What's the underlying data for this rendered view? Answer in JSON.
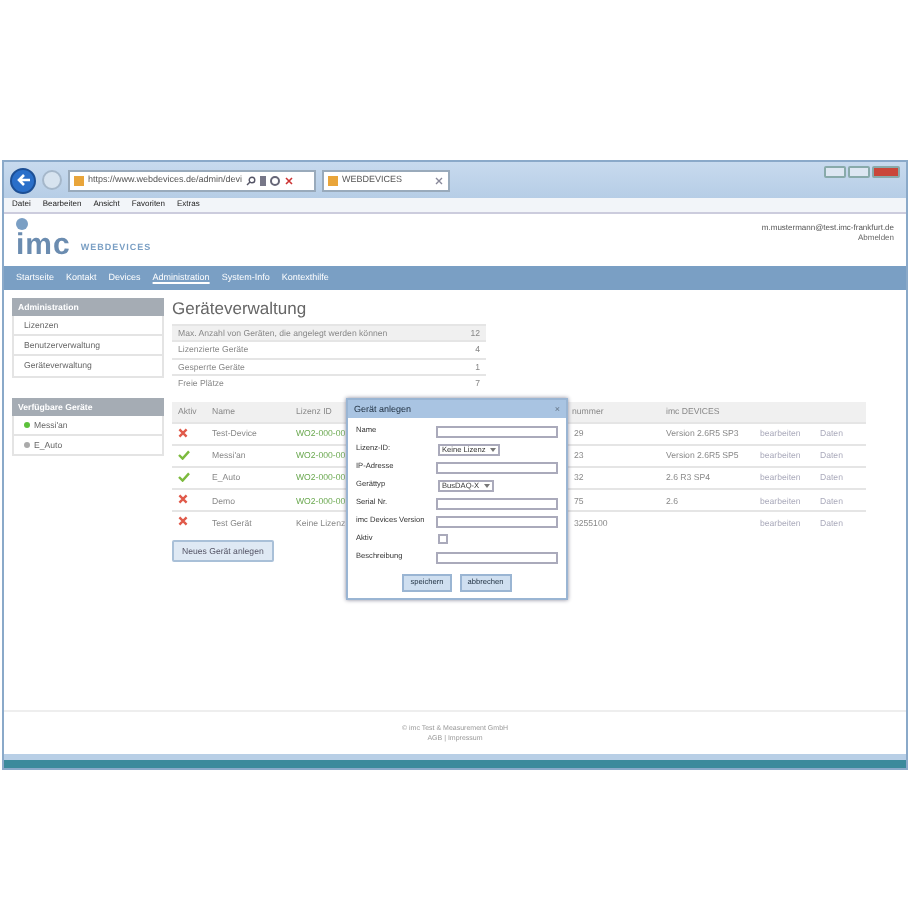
{
  "browser": {
    "address": "https://www.webdevices.de/admin/devi",
    "tab_title": "WEBDEVICES"
  },
  "menu": [
    "Datei",
    "Bearbeiten",
    "Ansicht",
    "Favoriten",
    "Extras"
  ],
  "header": {
    "logo": "imc",
    "brand": "WEBDEVICES",
    "user": "m.mustermann@test.imc-frankfurt.de",
    "logout": "Abmelden"
  },
  "nav": [
    {
      "label": "Startseite",
      "selected": false
    },
    {
      "label": "Kontakt",
      "selected": false
    },
    {
      "label": "Devices",
      "selected": false
    },
    {
      "label": "Administration",
      "selected": true
    },
    {
      "label": "System-Info",
      "selected": false
    },
    {
      "label": "Kontexthilfe",
      "selected": false
    }
  ],
  "sidebar": [
    {
      "title": "Administration",
      "items": [
        {
          "label": "Lizenzen"
        },
        {
          "label": "Benutzerverwaltung"
        },
        {
          "label": "Geräteverwaltung"
        }
      ]
    },
    {
      "title": "Verfügbare Geräte",
      "items": [
        {
          "label": "Messi'an",
          "online": true
        },
        {
          "label": "E_Auto",
          "online": false
        }
      ]
    }
  ],
  "page_title": "Geräteverwaltung",
  "stats": [
    {
      "label": "Max. Anzahl von Geräten, die angelegt werden können",
      "value": "12"
    },
    {
      "label": "Lizenzierte Geräte",
      "value": "4"
    },
    {
      "label": "Gesperrte Geräte",
      "value": "1"
    },
    {
      "label": "Freie Plätze",
      "value": "7"
    }
  ],
  "devices": {
    "columns": [
      "Aktiv",
      "Name",
      "Lizenz ID",
      "nummer",
      "imc DEVICES"
    ],
    "rows": [
      {
        "active": false,
        "name": "Test-Device",
        "license": "WO2-000-00",
        "licensed": true,
        "serial": "29",
        "version": "Version 2.6R5 SP3",
        "edit": "bearbeiten",
        "data": "Daten"
      },
      {
        "active": true,
        "name": "Messi'an",
        "license": "WO2-000-00",
        "licensed": true,
        "serial": "23",
        "version": "Version 2.6R5 SP5",
        "edit": "bearbeiten",
        "data": "Daten"
      },
      {
        "active": true,
        "name": "E_Auto",
        "license": "WO2-000-00",
        "licensed": true,
        "serial": "32",
        "version": "2.6 R3 SP4",
        "edit": "bearbeiten",
        "data": "Daten"
      },
      {
        "active": false,
        "name": "Demo",
        "license": "WO2-000-00",
        "licensed": true,
        "serial": "75",
        "version": "2.6",
        "edit": "bearbeiten",
        "data": "Daten"
      },
      {
        "active": false,
        "name": "Test Gerät",
        "license": "Keine Lizenz",
        "licensed": false,
        "serial": "3255100",
        "edit": "bearbeiten",
        "data": "Daten"
      }
    ]
  },
  "new_button": "Neues Gerät anlegen",
  "dialog": {
    "title": "Gerät anlegen",
    "close": "×",
    "fields": [
      {
        "kind": "text",
        "label": "Name"
      },
      {
        "kind": "select",
        "label": "Lizenz-ID:",
        "value": "Keine Lizenz"
      },
      {
        "kind": "text",
        "label": "IP-Adresse"
      },
      {
        "kind": "select",
        "label": "Gerättyp",
        "value": "BusDAQ-X"
      },
      {
        "kind": "text",
        "label": "Serial Nr."
      },
      {
        "kind": "text",
        "label": "imc Devices Version"
      },
      {
        "kind": "checkbox",
        "label": "Aktiv",
        "checked": false
      },
      {
        "kind": "text",
        "label": "Beschreibung"
      }
    ],
    "buttons": [
      "speichern",
      "abbrechen"
    ]
  },
  "footer": [
    "© imc Test & Measurement GmbH",
    "AGB | Impressum"
  ]
}
